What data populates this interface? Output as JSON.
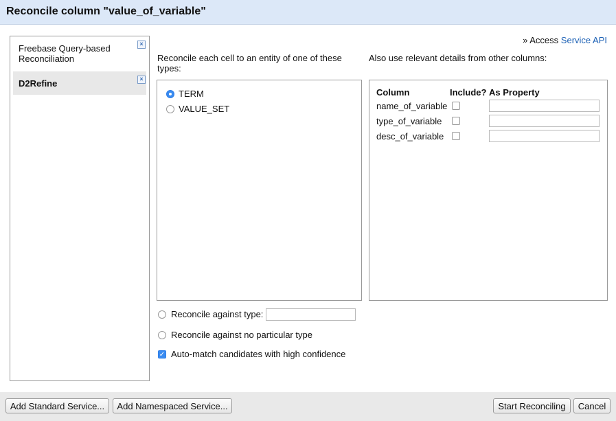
{
  "dialog": {
    "title": "Reconcile column \"value_of_variable\""
  },
  "services": [
    {
      "label": "Freebase Query-based Reconciliation",
      "selected": false
    },
    {
      "label": "D2Refine",
      "selected": true
    }
  ],
  "access": {
    "prefix": "» Access",
    "link": "Service API"
  },
  "types_heading": "Reconcile each cell to an entity of one of these types:",
  "types": [
    {
      "label": "TERM",
      "selected": true
    },
    {
      "label": "VALUE_SET",
      "selected": false
    }
  ],
  "details_heading": "Also use relevant details from other columns:",
  "columns_table": {
    "headers": {
      "column": "Column",
      "include": "Include?",
      "property": "As Property"
    },
    "rows": [
      {
        "name": "name_of_variable",
        "include": false,
        "property": ""
      },
      {
        "name": "type_of_variable",
        "include": false,
        "property": ""
      },
      {
        "name": "desc_of_variable",
        "include": false,
        "property": ""
      }
    ]
  },
  "options": {
    "against_type_label": "Reconcile against type:",
    "against_type_value": "",
    "no_type_label": "Reconcile against no particular type",
    "automatch_label": "Auto-match candidates with high confidence",
    "automatch_checked": true
  },
  "footer": {
    "add_standard": "Add Standard Service...",
    "add_namespaced": "Add Namespaced Service...",
    "start": "Start Reconciling",
    "cancel": "Cancel"
  }
}
